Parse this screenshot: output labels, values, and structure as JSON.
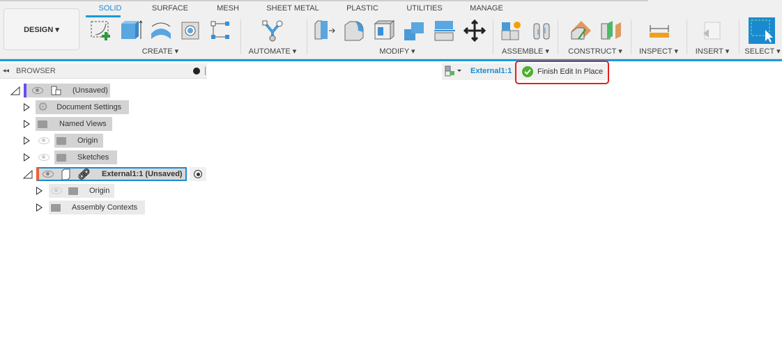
{
  "workspace": {
    "label": "DESIGN ▾"
  },
  "tabs": [
    "SOLID",
    "SURFACE",
    "MESH",
    "SHEET METAL",
    "PLASTIC",
    "UTILITIES",
    "MANAGE"
  ],
  "groups": [
    "CREATE ▾",
    "AUTOMATE ▾",
    "MODIFY ▾",
    "ASSEMBLE ▾",
    "CONSTRUCT ▾",
    "INSPECT ▾",
    "INSERT ▾",
    "SELECT ▾"
  ],
  "browser": {
    "title": "BROWSER",
    "items": [
      {
        "label": "(Unsaved)"
      },
      {
        "label": "Document Settings"
      },
      {
        "label": "Named Views"
      },
      {
        "label": "Origin"
      },
      {
        "label": "Sketches"
      },
      {
        "label": "External1:1 (Unsaved)"
      },
      {
        "label": "Origin"
      },
      {
        "label": "Assembly Contexts"
      }
    ]
  },
  "edit_bar": {
    "component": "External1:1",
    "finish_label": "Finish Edit In Place"
  },
  "colors": {
    "accent": "#1a9ad9",
    "highlight": "#e02020",
    "check": "#4caf30"
  }
}
